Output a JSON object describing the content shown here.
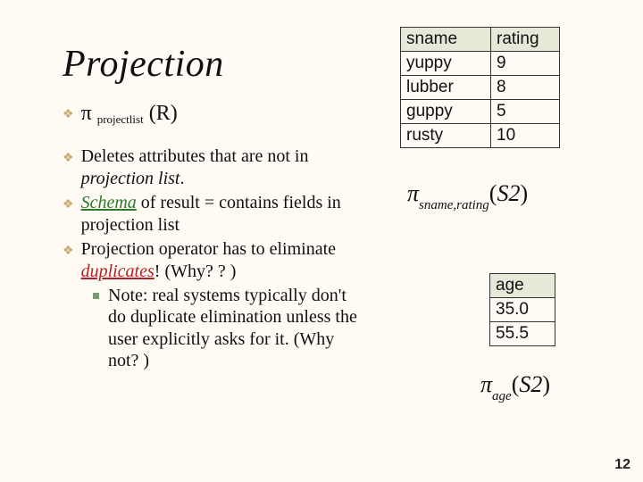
{
  "title": "Projection",
  "pi_line": {
    "pi": "π",
    "sub": "projectlist",
    "arg": "(R)"
  },
  "bullets": [
    {
      "pre": "Deletes attributes that are not in ",
      "em": "projection list",
      "post": "."
    },
    {
      "schema": "Schema",
      "mid": " of result =  contains fields in projection list"
    },
    {
      "pre": "Projection operator has to eliminate ",
      "dup": "duplicates",
      "post": "! (Why? ? )"
    }
  ],
  "note": "Note: real systems typically don't do duplicate elimination unless the user explicitly asks for it.  (Why not? )",
  "table1": {
    "headers": [
      "sname",
      "rating"
    ],
    "rows": [
      [
        "yuppy",
        "9"
      ],
      [
        "lubber",
        "8"
      ],
      [
        "guppy",
        "5"
      ],
      [
        "rusty",
        "10"
      ]
    ]
  },
  "formula1": {
    "pi": "π",
    "sub": "sname,rating",
    "arg": "S2"
  },
  "table2": {
    "header": "age",
    "rows": [
      "35.0",
      "55.5"
    ]
  },
  "formula2": {
    "pi": "π",
    "sub": "age",
    "arg": "S2"
  },
  "pagenum": "12"
}
